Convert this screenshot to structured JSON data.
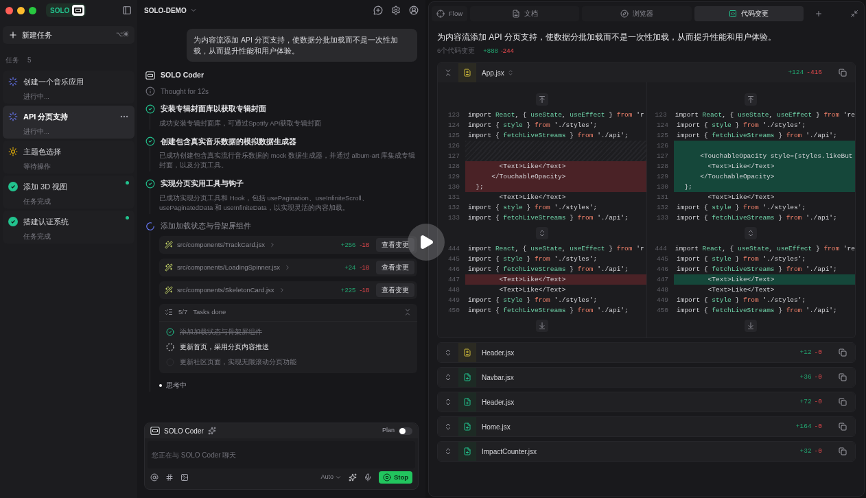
{
  "app": {
    "logo": "SOLO"
  },
  "sidebar": {
    "new_task": {
      "label": "新建任务",
      "shortcut": "⌥⌘"
    },
    "tasks_label": "任务",
    "tasks_count": "5",
    "tasks": [
      {
        "title": "创建一个音乐应用",
        "status": "进行中...",
        "kind": "running",
        "selected": false,
        "unread": false
      },
      {
        "title": "API 分页支持",
        "status": "进行中...",
        "kind": "running",
        "selected": true,
        "unread": false
      },
      {
        "title": "主题色选择",
        "status": "等待操作",
        "kind": "waiting",
        "selected": false,
        "unread": false
      },
      {
        "title": "添加 3D 视图",
        "status": "任务完成",
        "kind": "done",
        "selected": false,
        "unread": true
      },
      {
        "title": "搭建认证系统",
        "status": "任务完成",
        "kind": "done",
        "selected": false,
        "unread": true
      }
    ]
  },
  "chat": {
    "project": "SOLO-DEMO",
    "user_message": "为内容流添加 API 分页支持，使数据分批加载而不是一次性加载，从而提升性能和用户体验。",
    "agent": "SOLO Coder",
    "thought": "Thought for 12s",
    "steps": [
      {
        "title": "安装专辑封面库以获取专辑封面",
        "description": "成功安装专辑封面库，可通过Spotify API获取专辑封面",
        "kind": "done"
      },
      {
        "title": "创建包含真实音乐数据的模拟数据生成器",
        "description": "已成功创建包含真实流行音乐数据的 mock 数据生成器，并通过 album-art 库集成专辑封面，以及分页工具。",
        "kind": "done"
      },
      {
        "title": "实现分页实用工具与钩子",
        "description": "已成功实现分页工具和 Hook，包括 usePagination、useInfiniteScroll、usePaginatedData 和 useInfiniteData，以实现灵活的内容加载。",
        "kind": "done"
      },
      {
        "title": "添加加载状态与骨架屏组件",
        "kind": "running",
        "files": [
          {
            "path": "src/components/TrackCard.jsx",
            "added": "+256",
            "removed": "-18",
            "action": "查看变更"
          },
          {
            "path": "src/components/LoadingSpinner.jsx",
            "added": "+24",
            "removed": "-18",
            "action": "查看变更"
          },
          {
            "path": "src/components/SkeletonCard.jsx",
            "added": "+225",
            "removed": "-18",
            "action": "查看变更"
          }
        ]
      }
    ],
    "todo": {
      "progress": "5/7",
      "label": "Tasks done",
      "items": [
        {
          "text": "添加加载状态与骨架屏组件",
          "kind": "done"
        },
        {
          "text": "更新首页，采用分页内容推送",
          "kind": "running"
        },
        {
          "text": "更新社区页面，实现无限滚动分页功能",
          "kind": "pending"
        }
      ]
    },
    "status": "思考中",
    "composer": {
      "agent": "SOLO Coder",
      "mode_label": "Plan",
      "mode_on": false,
      "placeholder": "您正在与 SOLO Coder 聊天",
      "model": "Auto",
      "stop": "Stop"
    }
  },
  "panel": {
    "tabs": [
      {
        "label": "Flow",
        "kind": "flow",
        "selected": false
      },
      {
        "label": "文档",
        "kind": "docs",
        "selected": false
      },
      {
        "label": "浏览器",
        "kind": "browser",
        "selected": false
      },
      {
        "label": "代码变更",
        "kind": "changes",
        "selected": true
      }
    ],
    "title": "为内容流添加 API 分页支持，使数据分批加载而不是一次性加载，从而提升性能和用户体验。",
    "summary": "6个代码变更",
    "added": "+888",
    "removed": "-244",
    "files": [
      {
        "name": "App.jsx",
        "added": "+124",
        "removed": "-416",
        "kind": "modified",
        "expanded": true,
        "hunks": [
          {
            "left": [
              {
                "n": "123",
                "kind": "context",
                "tokens": [
                  {
                    "text": "import ",
                    "kind": "plain"
                  },
                  {
                    "text": "React",
                    "kind": "name"
                  },
                  {
                    "text": ", { ",
                    "kind": "plain"
                  },
                  {
                    "text": "useState",
                    "kind": "name"
                  },
                  {
                    "text": ", ",
                    "kind": "plain"
                  },
                  {
                    "text": "useEffect",
                    "kind": "name"
                  },
                  {
                    "text": " } ",
                    "kind": "plain"
                  },
                  {
                    "text": "from ",
                    "kind": "keyword"
                  },
                  {
                    "text": "'r",
                    "kind": "plain"
                  }
                ]
              },
              {
                "n": "124",
                "kind": "context",
                "tokens": [
                  {
                    "text": "import { ",
                    "kind": "plain"
                  },
                  {
                    "text": "style",
                    "kind": "name"
                  },
                  {
                    "text": " } ",
                    "kind": "plain"
                  },
                  {
                    "text": "from ",
                    "kind": "keyword"
                  },
                  {
                    "text": "'./styles';",
                    "kind": "plain"
                  }
                ]
              },
              {
                "n": "125",
                "kind": "context",
                "tokens": [
                  {
                    "text": "import { ",
                    "kind": "plain"
                  },
                  {
                    "text": "fetchLiveStreams",
                    "kind": "name"
                  },
                  {
                    "text": " } ",
                    "kind": "plain"
                  },
                  {
                    "text": "from ",
                    "kind": "keyword"
                  },
                  {
                    "text": "'./api';",
                    "kind": "plain"
                  }
                ]
              },
              {
                "n": "126",
                "kind": "filler"
              },
              {
                "n": "127",
                "kind": "filler"
              },
              {
                "n": "128",
                "kind": "removed",
                "tokens": [
                  {
                    "text": "        <Text>Like</Text>",
                    "kind": "plain"
                  }
                ]
              },
              {
                "n": "129",
                "kind": "removed",
                "tokens": [
                  {
                    "text": "      </TouchableOpacity>",
                    "kind": "plain"
                  }
                ]
              },
              {
                "n": "130",
                "kind": "removed",
                "tokens": [
                  {
                    "text": "  };",
                    "kind": "plain"
                  }
                ]
              },
              {
                "n": "131",
                "kind": "context",
                "tokens": [
                  {
                    "text": "        <Text>Like</Text>",
                    "kind": "plain"
                  }
                ]
              },
              {
                "n": "132",
                "kind": "context",
                "tokens": [
                  {
                    "text": "import { ",
                    "kind": "plain"
                  },
                  {
                    "text": "style",
                    "kind": "name"
                  },
                  {
                    "text": " } ",
                    "kind": "plain"
                  },
                  {
                    "text": "from ",
                    "kind": "keyword"
                  },
                  {
                    "text": "'./styles';",
                    "kind": "plain"
                  }
                ]
              },
              {
                "n": "133",
                "kind": "context",
                "tokens": [
                  {
                    "text": "import { ",
                    "kind": "plain"
                  },
                  {
                    "text": "fetchLiveStreams",
                    "kind": "name"
                  },
                  {
                    "text": " } ",
                    "kind": "plain"
                  },
                  {
                    "text": "from ",
                    "kind": "keyword"
                  },
                  {
                    "text": "'./api';",
                    "kind": "plain"
                  }
                ]
              }
            ],
            "right": [
              {
                "n": "123",
                "kind": "context",
                "tokens": [
                  {
                    "text": "import ",
                    "kind": "plain"
                  },
                  {
                    "text": "React",
                    "kind": "name"
                  },
                  {
                    "text": ", { ",
                    "kind": "plain"
                  },
                  {
                    "text": "useState",
                    "kind": "name"
                  },
                  {
                    "text": ", ",
                    "kind": "plain"
                  },
                  {
                    "text": "useEffect",
                    "kind": "name"
                  },
                  {
                    "text": " } ",
                    "kind": "plain"
                  },
                  {
                    "text": "from ",
                    "kind": "keyword"
                  },
                  {
                    "text": "'re",
                    "kind": "plain"
                  }
                ]
              },
              {
                "n": "124",
                "kind": "context",
                "tokens": [
                  {
                    "text": "import { ",
                    "kind": "plain"
                  },
                  {
                    "text": "style",
                    "kind": "name"
                  },
                  {
                    "text": " } ",
                    "kind": "plain"
                  },
                  {
                    "text": "from ",
                    "kind": "keyword"
                  },
                  {
                    "text": "'./styles';",
                    "kind": "plain"
                  }
                ]
              },
              {
                "n": "125",
                "kind": "context",
                "tokens": [
                  {
                    "text": "import { ",
                    "kind": "plain"
                  },
                  {
                    "text": "fetchLiveStreams",
                    "kind": "name"
                  },
                  {
                    "text": " } ",
                    "kind": "plain"
                  },
                  {
                    "text": "from ",
                    "kind": "keyword"
                  },
                  {
                    "text": "'./api';",
                    "kind": "plain"
                  }
                ]
              },
              {
                "n": "126",
                "kind": "added"
              },
              {
                "n": "127",
                "kind": "added",
                "tokens": [
                  {
                    "text": "      <TouchableOpacity style={styles.likeBut",
                    "kind": "plain"
                  }
                ]
              },
              {
                "n": "128",
                "kind": "added",
                "tokens": [
                  {
                    "text": "        <Text>Like</Text>",
                    "kind": "plain"
                  }
                ]
              },
              {
                "n": "129",
                "kind": "added",
                "tokens": [
                  {
                    "text": "      </TouchableOpacity>",
                    "kind": "plain"
                  }
                ]
              },
              {
                "n": "130",
                "kind": "added",
                "tokens": [
                  {
                    "text": "  };",
                    "kind": "plain"
                  }
                ]
              },
              {
                "n": "131",
                "kind": "context",
                "tokens": [
                  {
                    "text": "        <Text>Like</Text>",
                    "kind": "plain"
                  }
                ]
              },
              {
                "n": "132",
                "kind": "context",
                "tokens": [
                  {
                    "text": "import { ",
                    "kind": "plain"
                  },
                  {
                    "text": "style",
                    "kind": "name"
                  },
                  {
                    "text": " } ",
                    "kind": "plain"
                  },
                  {
                    "text": "from ",
                    "kind": "keyword"
                  },
                  {
                    "text": "'./styles';",
                    "kind": "plain"
                  }
                ]
              },
              {
                "n": "133",
                "kind": "context",
                "tokens": [
                  {
                    "text": "import { ",
                    "kind": "plain"
                  },
                  {
                    "text": "fetchLiveStreams",
                    "kind": "name"
                  },
                  {
                    "text": " } ",
                    "kind": "plain"
                  },
                  {
                    "text": "from ",
                    "kind": "keyword"
                  },
                  {
                    "text": "'./api';",
                    "kind": "plain"
                  }
                ]
              }
            ]
          },
          {
            "left": [
              {
                "n": "444",
                "kind": "context",
                "tokens": [
                  {
                    "text": "import ",
                    "kind": "plain"
                  },
                  {
                    "text": "React",
                    "kind": "name"
                  },
                  {
                    "text": ", { ",
                    "kind": "plain"
                  },
                  {
                    "text": "useState",
                    "kind": "name"
                  },
                  {
                    "text": ", ",
                    "kind": "plain"
                  },
                  {
                    "text": "useEffect",
                    "kind": "name"
                  },
                  {
                    "text": " } ",
                    "kind": "plain"
                  },
                  {
                    "text": "from ",
                    "kind": "keyword"
                  },
                  {
                    "text": "'r",
                    "kind": "plain"
                  }
                ]
              },
              {
                "n": "445",
                "kind": "context",
                "tokens": [
                  {
                    "text": "import { ",
                    "kind": "plain"
                  },
                  {
                    "text": "style",
                    "kind": "name"
                  },
                  {
                    "text": " } ",
                    "kind": "plain"
                  },
                  {
                    "text": "from ",
                    "kind": "keyword"
                  },
                  {
                    "text": "'./styles';",
                    "kind": "plain"
                  }
                ]
              },
              {
                "n": "446",
                "kind": "context",
                "tokens": [
                  {
                    "text": "import { ",
                    "kind": "plain"
                  },
                  {
                    "text": "fetchLiveStreams",
                    "kind": "name"
                  },
                  {
                    "text": " } ",
                    "kind": "plain"
                  },
                  {
                    "text": "from ",
                    "kind": "keyword"
                  },
                  {
                    "text": "'./api';",
                    "kind": "plain"
                  }
                ]
              },
              {
                "n": "447",
                "kind": "removed",
                "tokens": [
                  {
                    "text": "        <Text>Like</Text>",
                    "kind": "plain"
                  }
                ]
              },
              {
                "n": "448",
                "kind": "context",
                "tokens": [
                  {
                    "text": "        <Text>Like</Text>",
                    "kind": "plain"
                  }
                ]
              },
              {
                "n": "449",
                "kind": "context",
                "tokens": [
                  {
                    "text": "import { ",
                    "kind": "plain"
                  },
                  {
                    "text": "style",
                    "kind": "name"
                  },
                  {
                    "text": " } ",
                    "kind": "plain"
                  },
                  {
                    "text": "from ",
                    "kind": "keyword"
                  },
                  {
                    "text": "'./styles';",
                    "kind": "plain"
                  }
                ]
              },
              {
                "n": "450",
                "kind": "context",
                "tokens": [
                  {
                    "text": "import { ",
                    "kind": "plain"
                  },
                  {
                    "text": "fetchLiveStreams",
                    "kind": "name"
                  },
                  {
                    "text": " } ",
                    "kind": "plain"
                  },
                  {
                    "text": "from ",
                    "kind": "keyword"
                  },
                  {
                    "text": "'./api';",
                    "kind": "plain"
                  }
                ]
              }
            ],
            "right": [
              {
                "n": "444",
                "kind": "context",
                "tokens": [
                  {
                    "text": "import ",
                    "kind": "plain"
                  },
                  {
                    "text": "React",
                    "kind": "name"
                  },
                  {
                    "text": ", { ",
                    "kind": "plain"
                  },
                  {
                    "text": "useState",
                    "kind": "name"
                  },
                  {
                    "text": ", ",
                    "kind": "plain"
                  },
                  {
                    "text": "useEffect",
                    "kind": "name"
                  },
                  {
                    "text": " } ",
                    "kind": "plain"
                  },
                  {
                    "text": "from ",
                    "kind": "keyword"
                  },
                  {
                    "text": "'re",
                    "kind": "plain"
                  }
                ]
              },
              {
                "n": "445",
                "kind": "context",
                "tokens": [
                  {
                    "text": "import { ",
                    "kind": "plain"
                  },
                  {
                    "text": "style",
                    "kind": "name"
                  },
                  {
                    "text": " } ",
                    "kind": "plain"
                  },
                  {
                    "text": "from ",
                    "kind": "keyword"
                  },
                  {
                    "text": "'./styles';",
                    "kind": "plain"
                  }
                ]
              },
              {
                "n": "446",
                "kind": "context",
                "tokens": [
                  {
                    "text": "import { ",
                    "kind": "plain"
                  },
                  {
                    "text": "fetchLiveStreams",
                    "kind": "name"
                  },
                  {
                    "text": " } ",
                    "kind": "plain"
                  },
                  {
                    "text": "from ",
                    "kind": "keyword"
                  },
                  {
                    "text": "'./api';",
                    "kind": "plain"
                  }
                ]
              },
              {
                "n": "447",
                "kind": "added",
                "tokens": [
                  {
                    "text": "        <Text>Like</Text>",
                    "kind": "plain"
                  }
                ]
              },
              {
                "n": "448",
                "kind": "context",
                "tokens": [
                  {
                    "text": "        <Text>Like</Text>",
                    "kind": "plain"
                  }
                ]
              },
              {
                "n": "449",
                "kind": "context",
                "tokens": [
                  {
                    "text": "import { ",
                    "kind": "plain"
                  },
                  {
                    "text": "style",
                    "kind": "name"
                  },
                  {
                    "text": " } ",
                    "kind": "plain"
                  },
                  {
                    "text": "from ",
                    "kind": "keyword"
                  },
                  {
                    "text": "'./styles';",
                    "kind": "plain"
                  }
                ]
              },
              {
                "n": "450",
                "kind": "context",
                "tokens": [
                  {
                    "text": "import { ",
                    "kind": "plain"
                  },
                  {
                    "text": "fetchLiveStreams",
                    "kind": "name"
                  },
                  {
                    "text": " } ",
                    "kind": "plain"
                  },
                  {
                    "text": "from ",
                    "kind": "keyword"
                  },
                  {
                    "text": "'./api';",
                    "kind": "plain"
                  }
                ]
              }
            ]
          }
        ]
      },
      {
        "name": "Header.jsx",
        "added": "+12",
        "removed": "-0",
        "kind": "modified",
        "expanded": false
      },
      {
        "name": "Navbar.jsx",
        "added": "+36",
        "removed": "-0",
        "kind": "added",
        "expanded": false
      },
      {
        "name": "Header.jsx",
        "added": "+72",
        "removed": "-0",
        "kind": "added",
        "expanded": false
      },
      {
        "name": "Home.jsx",
        "added": "+164",
        "removed": "-0",
        "kind": "added",
        "expanded": false
      },
      {
        "name": "ImpactCounter.jsx",
        "added": "+32",
        "removed": "-0",
        "kind": "added",
        "expanded": false
      }
    ]
  }
}
